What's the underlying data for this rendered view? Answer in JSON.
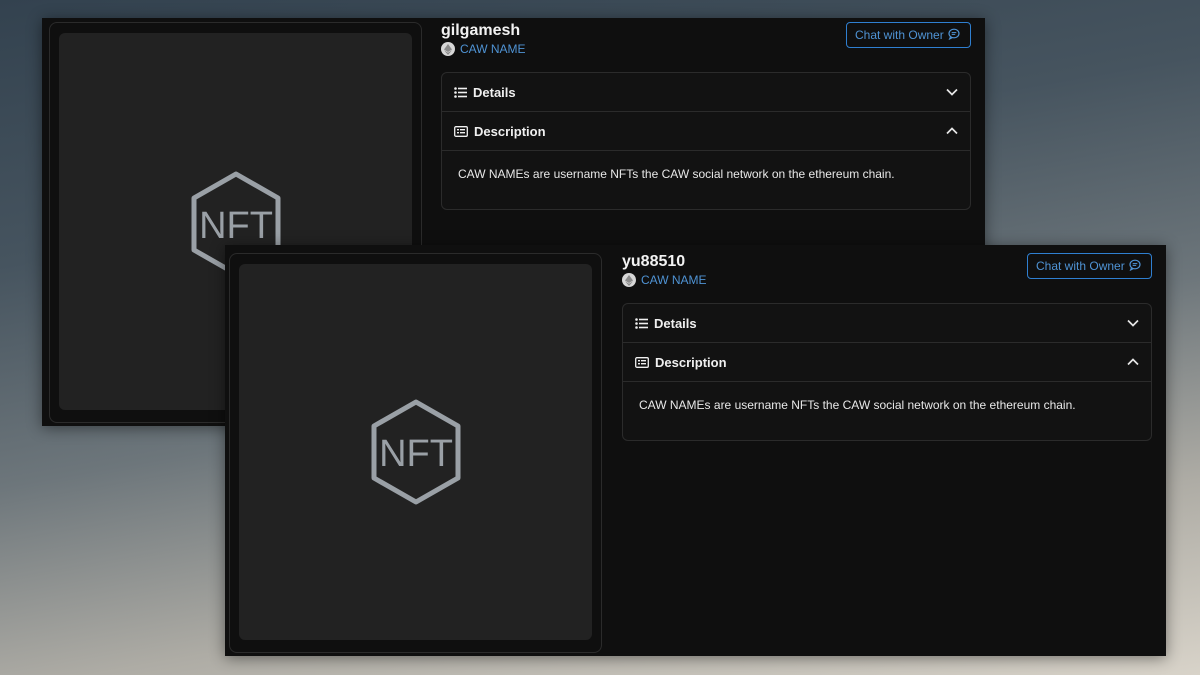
{
  "cards": [
    {
      "title": "gilgamesh",
      "collection": "CAW NAME",
      "chat_label": "Chat with Owner",
      "media_label": "NFT",
      "sections": {
        "details": "Details",
        "description": "Description"
      },
      "description_text": "CAW NAMEs are username NFTs the CAW social network on the ethereum chain."
    },
    {
      "title": "yu88510",
      "collection": "CAW NAME",
      "chat_label": "Chat with Owner",
      "media_label": "NFT",
      "sections": {
        "details": "Details",
        "description": "Description"
      },
      "description_text": "CAW NAMEs are username NFTs the CAW social network on the ethereum chain."
    }
  ],
  "colors": {
    "accent": "#4f93d4",
    "panel_bg": "#0f0f0f",
    "media_bg": "#222222",
    "logo_stroke": "#9aa0a6"
  },
  "icons": {
    "chain": "ethereum-icon",
    "chat": "chat-bubble-icon",
    "details": "list-icon",
    "description": "document-list-icon",
    "collapsed": "chevron-down-icon",
    "expanded": "chevron-up-icon"
  }
}
